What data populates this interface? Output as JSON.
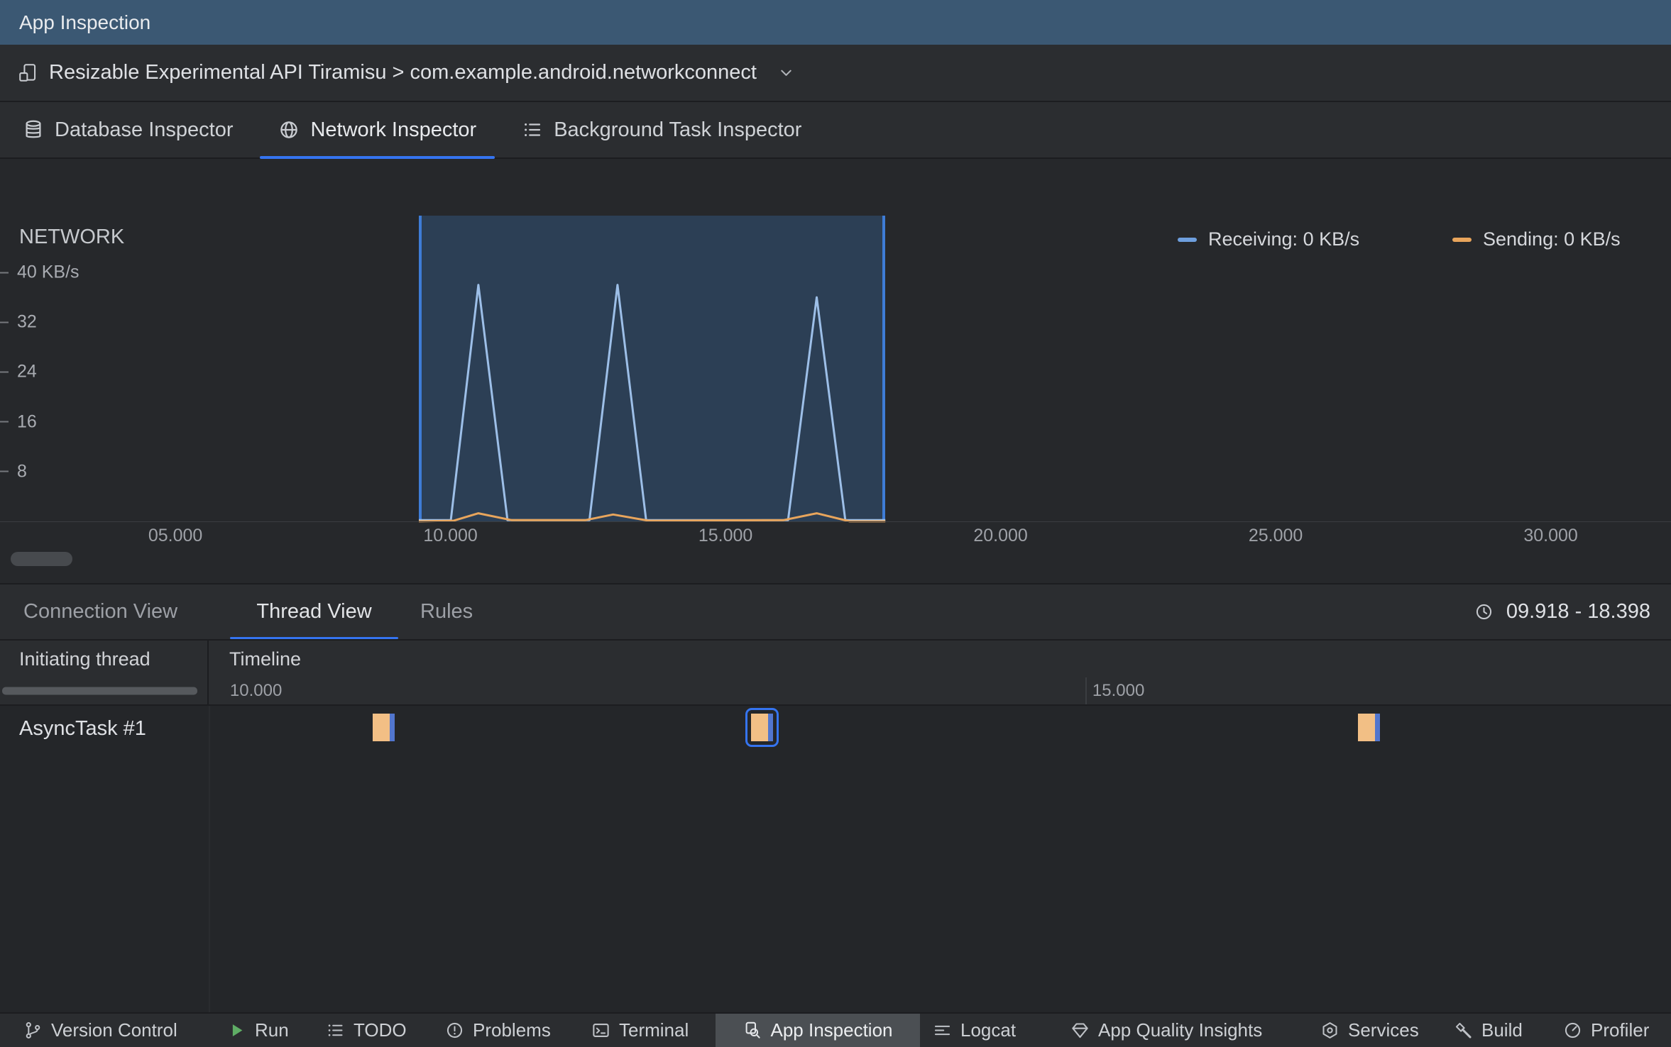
{
  "colors": {
    "accent_blue": "#3574F0",
    "selection_border": "#3E7CD6",
    "title_bar_bg": "#3B5873",
    "panel_bg": "#2B2D30"
  },
  "title_bar": {
    "title": "App Inspection"
  },
  "device_bar": {
    "label": "Resizable Experimental API Tiramisu > com.example.android.networkconnect"
  },
  "inspector_tabs": [
    {
      "label": "Database Inspector",
      "active": false
    },
    {
      "label": "Network Inspector",
      "active": true
    },
    {
      "label": "Background Task Inspector",
      "active": false
    }
  ],
  "chart_data": {
    "type": "line",
    "title": "NETWORK",
    "ylabel": "KB/s",
    "x_unit": "seconds",
    "ylim": [
      0,
      40
    ],
    "grid": false,
    "legend_position": "top-right",
    "selection": {
      "start": 9.918,
      "end": 18.398
    },
    "y_ticks": [
      {
        "value": 40,
        "label": "40 KB/s"
      },
      {
        "value": 32,
        "label": "32"
      },
      {
        "value": 24,
        "label": "24"
      },
      {
        "value": 16,
        "label": "16"
      },
      {
        "value": 8,
        "label": "8"
      }
    ],
    "x_ticks": [
      {
        "value": 5,
        "label": "05.000"
      },
      {
        "value": 10,
        "label": "10.000"
      },
      {
        "value": 15,
        "label": "15.000"
      },
      {
        "value": 20,
        "label": "20.000"
      },
      {
        "value": 25,
        "label": "25.000"
      },
      {
        "value": 30,
        "label": "30.000"
      }
    ],
    "legend": [
      {
        "label": "Receiving: 0 KB/s",
        "color": "#6E9FDE"
      },
      {
        "label": "Sending: 0 KB/s",
        "color": "#E8A55C"
      }
    ],
    "series": [
      {
        "name": "Receiving",
        "unit": "KB/s",
        "color": "#9DBFE8",
        "points": [
          [
            9.918,
            0.2
          ],
          [
            10.5,
            0.2
          ],
          [
            11.0,
            38
          ],
          [
            11.53,
            0.2
          ],
          [
            13.02,
            0.2
          ],
          [
            13.53,
            38
          ],
          [
            14.05,
            0.2
          ],
          [
            16.63,
            0.2
          ],
          [
            17.15,
            36
          ],
          [
            17.67,
            0.2
          ],
          [
            18.398,
            0.2
          ]
        ]
      },
      {
        "name": "Sending",
        "unit": "KB/s",
        "color": "#E8A55C",
        "points": [
          [
            9.918,
            0
          ],
          [
            10.55,
            0.1
          ],
          [
            11.0,
            1.3
          ],
          [
            11.6,
            0.2
          ],
          [
            12.95,
            0.2
          ],
          [
            13.45,
            1.1
          ],
          [
            14.1,
            0.1
          ],
          [
            16.55,
            0.2
          ],
          [
            17.15,
            1.3
          ],
          [
            17.75,
            0
          ],
          [
            18.398,
            0
          ]
        ]
      }
    ]
  },
  "thread_view": {
    "tabs": [
      {
        "label": "Connection View",
        "active": false
      },
      {
        "label": "Thread View",
        "active": true
      },
      {
        "label": "Rules",
        "active": false
      }
    ],
    "selection_range": "09.918 - 18.398",
    "columns": [
      "Initiating thread",
      "Timeline"
    ],
    "timeline_ticks": [
      {
        "value": 10,
        "label": "10.000"
      },
      {
        "value": 15,
        "label": "15.000"
      }
    ],
    "event_colors": {
      "send": "#F2BF85",
      "receive": "#5276CE"
    },
    "rows": [
      {
        "thread": "AsyncTask #1",
        "events": [
          {
            "time": 10.87,
            "selected": false
          },
          {
            "time": 13.06,
            "selected": true
          },
          {
            "time": 16.58,
            "selected": false
          }
        ]
      }
    ]
  },
  "status_bar": {
    "items": [
      {
        "label": "Version Control",
        "active": false
      },
      {
        "label": "Run",
        "active": false
      },
      {
        "label": "TODO",
        "active": false
      },
      {
        "label": "Problems",
        "active": false
      },
      {
        "label": "Terminal",
        "active": false
      },
      {
        "label": "App Inspection",
        "active": true
      },
      {
        "label": "Logcat",
        "active": false
      },
      {
        "label": "App Quality Insights",
        "active": false
      },
      {
        "label": "Services",
        "active": false
      },
      {
        "label": "Build",
        "active": false
      },
      {
        "label": "Profiler",
        "active": false
      }
    ]
  }
}
